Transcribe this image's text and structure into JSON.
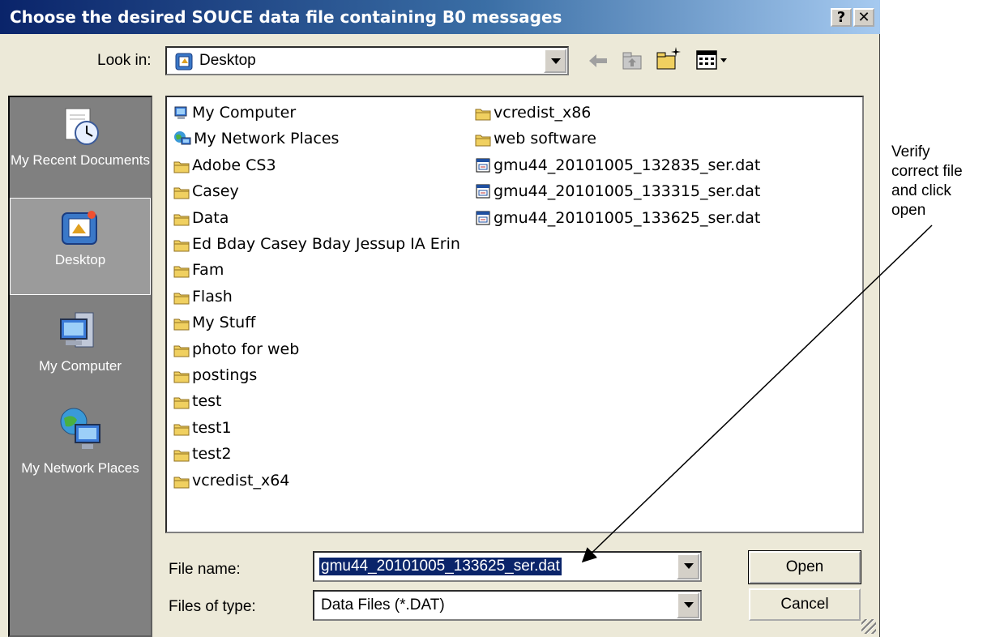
{
  "title": "Choose the desired SOUCE data file containing B0 messages",
  "title_buttons": {
    "help": "?",
    "close": "✕"
  },
  "look_in": {
    "label": "Look in:",
    "value": "Desktop"
  },
  "places": [
    {
      "label": "My Recent Documents",
      "icon": "recent-documents-icon"
    },
    {
      "label": "Desktop",
      "icon": "desktop-icon",
      "selected": true
    },
    {
      "label": "My Computer",
      "icon": "my-computer-icon"
    },
    {
      "label": "My Network Places",
      "icon": "network-places-icon"
    }
  ],
  "files_col1": [
    {
      "name": "My Computer",
      "icon": "computer"
    },
    {
      "name": "My Network Places",
      "icon": "network"
    },
    {
      "name": "Adobe CS3",
      "icon": "folder"
    },
    {
      "name": "Casey",
      "icon": "folder"
    },
    {
      "name": "Data",
      "icon": "folder"
    },
    {
      "name": "Ed Bday Casey Bday Jessup IA Erin",
      "icon": "folder"
    },
    {
      "name": "Fam",
      "icon": "folder"
    },
    {
      "name": "Flash",
      "icon": "folder"
    },
    {
      "name": "My Stuff",
      "icon": "folder"
    },
    {
      "name": "photo for web",
      "icon": "folder"
    },
    {
      "name": "postings",
      "icon": "folder"
    },
    {
      "name": "test",
      "icon": "folder"
    },
    {
      "name": "test1",
      "icon": "folder"
    },
    {
      "name": "test2",
      "icon": "folder"
    },
    {
      "name": "vcredist_x64",
      "icon": "folder"
    }
  ],
  "files_col2": [
    {
      "name": "vcredist_x86",
      "icon": "folder"
    },
    {
      "name": "web software",
      "icon": "folder"
    },
    {
      "name": "gmu44_20101005_132835_ser.dat",
      "icon": "datafile"
    },
    {
      "name": "gmu44_20101005_133315_ser.dat",
      "icon": "datafile"
    },
    {
      "name": "gmu44_20101005_133625_ser.dat",
      "icon": "datafile"
    }
  ],
  "file_name": {
    "label": "File name:",
    "value": "gmu44_20101005_133625_ser.dat"
  },
  "file_type": {
    "label": "Files of type:",
    "value": "Data Files (*.DAT)"
  },
  "buttons": {
    "open": "Open",
    "cancel": "Cancel"
  },
  "annotation": "Verify correct file and click open",
  "colors": {
    "title_start": "#0a246a",
    "title_end": "#a6caf0",
    "folder": "#f0d060",
    "places_bg": "#808080"
  }
}
